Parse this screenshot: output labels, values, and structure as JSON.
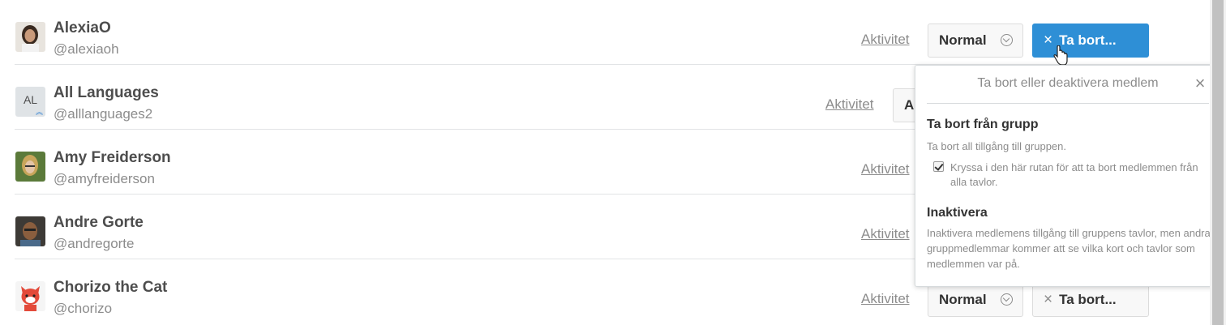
{
  "members": [
    {
      "name": "AlexiaO",
      "handle": "@alexiaoh",
      "avatar": "photo-alexia",
      "activity": "Aktivitet",
      "permission": "Normal",
      "remove": "Ta bort...",
      "remove_active": true
    },
    {
      "name": "All Languages",
      "handle": "@alllanguages2",
      "avatar_initials": "AL",
      "activity": "Aktivitet",
      "permission": "A"
    },
    {
      "name": "Amy Freiderson",
      "handle": "@amyfreiderson",
      "avatar": "photo-amy",
      "activity": "Aktivitet"
    },
    {
      "name": "Andre Gorte",
      "handle": "@andregorte",
      "avatar": "photo-andre",
      "activity": "Aktivitet"
    },
    {
      "name": "Chorizo the Cat",
      "handle": "@chorizo",
      "avatar": "photo-chorizo",
      "activity": "Aktivitet",
      "permission": "Normal",
      "remove": "Ta bort..."
    }
  ],
  "icons": {
    "remove": "×",
    "close": "×",
    "chevron": "chevron-down-circle-icon",
    "cursor": "hand-pointer-icon"
  },
  "popover": {
    "title": "Ta bort eller deaktivera medlem",
    "remove_heading": "Ta bort från grupp",
    "remove_desc": "Ta bort all tillgång till gruppen.",
    "checkbox_label": "Kryssa i den här rutan för att ta bort medlemmen från alla tavlor.",
    "checkbox_checked": true,
    "deactivate_heading": "Inaktivera",
    "deactivate_desc": "Inaktivera medlemens tillgång till gruppens tavlor, men andra gruppmedlemmar kommer att se vilka kort och tavlor som medlemmen var på."
  },
  "colors": {
    "accent": "#2e8fd6",
    "text": "#4d4d4d",
    "muted": "#8c8c8c"
  }
}
